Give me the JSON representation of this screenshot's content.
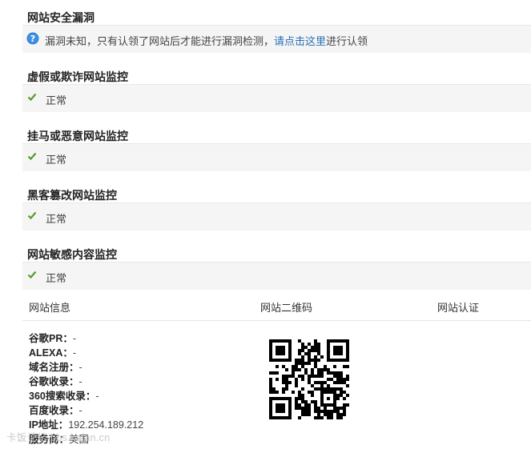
{
  "sections": [
    {
      "title": "网站安全漏洞",
      "notice": {
        "text_before": "漏洞未知，只有认领了网站后才能进行漏洞检测，",
        "link": "请点击这里",
        "text_after": "进行认领",
        "icon": "question-icon"
      }
    },
    {
      "title": "虚假或欺诈网站监控",
      "status": "正常",
      "icon": "check-icon"
    },
    {
      "title": "挂马或恶意网站监控",
      "status": "正常",
      "icon": "check-icon"
    },
    {
      "title": "黑客篡改网站监控",
      "status": "正常",
      "icon": "check-icon"
    },
    {
      "title": "网站敏感内容监控",
      "status": "正常",
      "icon": "check-icon"
    }
  ],
  "info_table": {
    "headers": [
      "网站信息",
      "网站二维码",
      "网站认证"
    ],
    "rows": [
      {
        "label": "谷歌PR：",
        "value": "-"
      },
      {
        "label": "ALEXA：",
        "value": "-"
      },
      {
        "label": "域名注册：",
        "value": "-"
      },
      {
        "label": "谷歌收录：",
        "value": "-"
      },
      {
        "label": "360搜索收录：",
        "value": "-"
      },
      {
        "label": "百度收录：",
        "value": "-"
      },
      {
        "label": "IP地址：",
        "value": "192.254.189.212"
      },
      {
        "label": "服务商：",
        "value": "美国"
      }
    ]
  },
  "watermark": "卡饭论坛 bbs.kafan.cn",
  "colors": {
    "check": "#5a9a2a",
    "link": "#2a6fb8",
    "row_bg": "#f5f5f5",
    "info_icon": "#2b7bd0"
  }
}
